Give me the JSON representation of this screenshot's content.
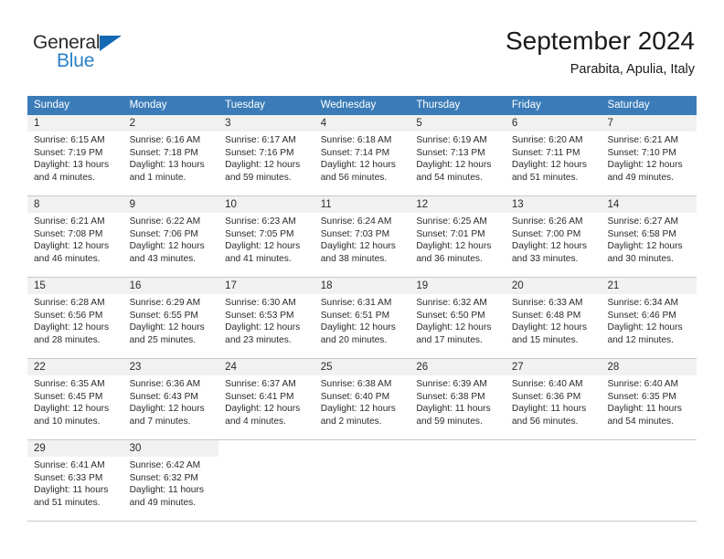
{
  "brand": {
    "name_top": "General",
    "name_bottom": "Blue",
    "color_top": "#2b2b2b",
    "color_bottom": "#2a80c8",
    "accent": "#1569b4"
  },
  "header": {
    "title": "September 2024",
    "subtitle": "Parabita, Apulia, Italy"
  },
  "theme": {
    "header_blue": "#3b7cb8",
    "day_band_gray": "#f1f1f1",
    "divider_gray": "#c8c8c8"
  },
  "weekdays": [
    "Sunday",
    "Monday",
    "Tuesday",
    "Wednesday",
    "Thursday",
    "Friday",
    "Saturday"
  ],
  "weeks": [
    [
      {
        "day": "1",
        "lines": [
          "Sunrise: 6:15 AM",
          "Sunset: 7:19 PM",
          "Daylight: 13 hours",
          "and 4 minutes."
        ]
      },
      {
        "day": "2",
        "lines": [
          "Sunrise: 6:16 AM",
          "Sunset: 7:18 PM",
          "Daylight: 13 hours",
          "and 1 minute."
        ]
      },
      {
        "day": "3",
        "lines": [
          "Sunrise: 6:17 AM",
          "Sunset: 7:16 PM",
          "Daylight: 12 hours",
          "and 59 minutes."
        ]
      },
      {
        "day": "4",
        "lines": [
          "Sunrise: 6:18 AM",
          "Sunset: 7:14 PM",
          "Daylight: 12 hours",
          "and 56 minutes."
        ]
      },
      {
        "day": "5",
        "lines": [
          "Sunrise: 6:19 AM",
          "Sunset: 7:13 PM",
          "Daylight: 12 hours",
          "and 54 minutes."
        ]
      },
      {
        "day": "6",
        "lines": [
          "Sunrise: 6:20 AM",
          "Sunset: 7:11 PM",
          "Daylight: 12 hours",
          "and 51 minutes."
        ]
      },
      {
        "day": "7",
        "lines": [
          "Sunrise: 6:21 AM",
          "Sunset: 7:10 PM",
          "Daylight: 12 hours",
          "and 49 minutes."
        ]
      }
    ],
    [
      {
        "day": "8",
        "lines": [
          "Sunrise: 6:21 AM",
          "Sunset: 7:08 PM",
          "Daylight: 12 hours",
          "and 46 minutes."
        ]
      },
      {
        "day": "9",
        "lines": [
          "Sunrise: 6:22 AM",
          "Sunset: 7:06 PM",
          "Daylight: 12 hours",
          "and 43 minutes."
        ]
      },
      {
        "day": "10",
        "lines": [
          "Sunrise: 6:23 AM",
          "Sunset: 7:05 PM",
          "Daylight: 12 hours",
          "and 41 minutes."
        ]
      },
      {
        "day": "11",
        "lines": [
          "Sunrise: 6:24 AM",
          "Sunset: 7:03 PM",
          "Daylight: 12 hours",
          "and 38 minutes."
        ]
      },
      {
        "day": "12",
        "lines": [
          "Sunrise: 6:25 AM",
          "Sunset: 7:01 PM",
          "Daylight: 12 hours",
          "and 36 minutes."
        ]
      },
      {
        "day": "13",
        "lines": [
          "Sunrise: 6:26 AM",
          "Sunset: 7:00 PM",
          "Daylight: 12 hours",
          "and 33 minutes."
        ]
      },
      {
        "day": "14",
        "lines": [
          "Sunrise: 6:27 AM",
          "Sunset: 6:58 PM",
          "Daylight: 12 hours",
          "and 30 minutes."
        ]
      }
    ],
    [
      {
        "day": "15",
        "lines": [
          "Sunrise: 6:28 AM",
          "Sunset: 6:56 PM",
          "Daylight: 12 hours",
          "and 28 minutes."
        ]
      },
      {
        "day": "16",
        "lines": [
          "Sunrise: 6:29 AM",
          "Sunset: 6:55 PM",
          "Daylight: 12 hours",
          "and 25 minutes."
        ]
      },
      {
        "day": "17",
        "lines": [
          "Sunrise: 6:30 AM",
          "Sunset: 6:53 PM",
          "Daylight: 12 hours",
          "and 23 minutes."
        ]
      },
      {
        "day": "18",
        "lines": [
          "Sunrise: 6:31 AM",
          "Sunset: 6:51 PM",
          "Daylight: 12 hours",
          "and 20 minutes."
        ]
      },
      {
        "day": "19",
        "lines": [
          "Sunrise: 6:32 AM",
          "Sunset: 6:50 PM",
          "Daylight: 12 hours",
          "and 17 minutes."
        ]
      },
      {
        "day": "20",
        "lines": [
          "Sunrise: 6:33 AM",
          "Sunset: 6:48 PM",
          "Daylight: 12 hours",
          "and 15 minutes."
        ]
      },
      {
        "day": "21",
        "lines": [
          "Sunrise: 6:34 AM",
          "Sunset: 6:46 PM",
          "Daylight: 12 hours",
          "and 12 minutes."
        ]
      }
    ],
    [
      {
        "day": "22",
        "lines": [
          "Sunrise: 6:35 AM",
          "Sunset: 6:45 PM",
          "Daylight: 12 hours",
          "and 10 minutes."
        ]
      },
      {
        "day": "23",
        "lines": [
          "Sunrise: 6:36 AM",
          "Sunset: 6:43 PM",
          "Daylight: 12 hours",
          "and 7 minutes."
        ]
      },
      {
        "day": "24",
        "lines": [
          "Sunrise: 6:37 AM",
          "Sunset: 6:41 PM",
          "Daylight: 12 hours",
          "and 4 minutes."
        ]
      },
      {
        "day": "25",
        "lines": [
          "Sunrise: 6:38 AM",
          "Sunset: 6:40 PM",
          "Daylight: 12 hours",
          "and 2 minutes."
        ]
      },
      {
        "day": "26",
        "lines": [
          "Sunrise: 6:39 AM",
          "Sunset: 6:38 PM",
          "Daylight: 11 hours",
          "and 59 minutes."
        ]
      },
      {
        "day": "27",
        "lines": [
          "Sunrise: 6:40 AM",
          "Sunset: 6:36 PM",
          "Daylight: 11 hours",
          "and 56 minutes."
        ]
      },
      {
        "day": "28",
        "lines": [
          "Sunrise: 6:40 AM",
          "Sunset: 6:35 PM",
          "Daylight: 11 hours",
          "and 54 minutes."
        ]
      }
    ],
    [
      {
        "day": "29",
        "lines": [
          "Sunrise: 6:41 AM",
          "Sunset: 6:33 PM",
          "Daylight: 11 hours",
          "and 51 minutes."
        ]
      },
      {
        "day": "30",
        "lines": [
          "Sunrise: 6:42 AM",
          "Sunset: 6:32 PM",
          "Daylight: 11 hours",
          "and 49 minutes."
        ]
      },
      {
        "day": "",
        "lines": []
      },
      {
        "day": "",
        "lines": []
      },
      {
        "day": "",
        "lines": []
      },
      {
        "day": "",
        "lines": []
      },
      {
        "day": "",
        "lines": []
      }
    ]
  ]
}
